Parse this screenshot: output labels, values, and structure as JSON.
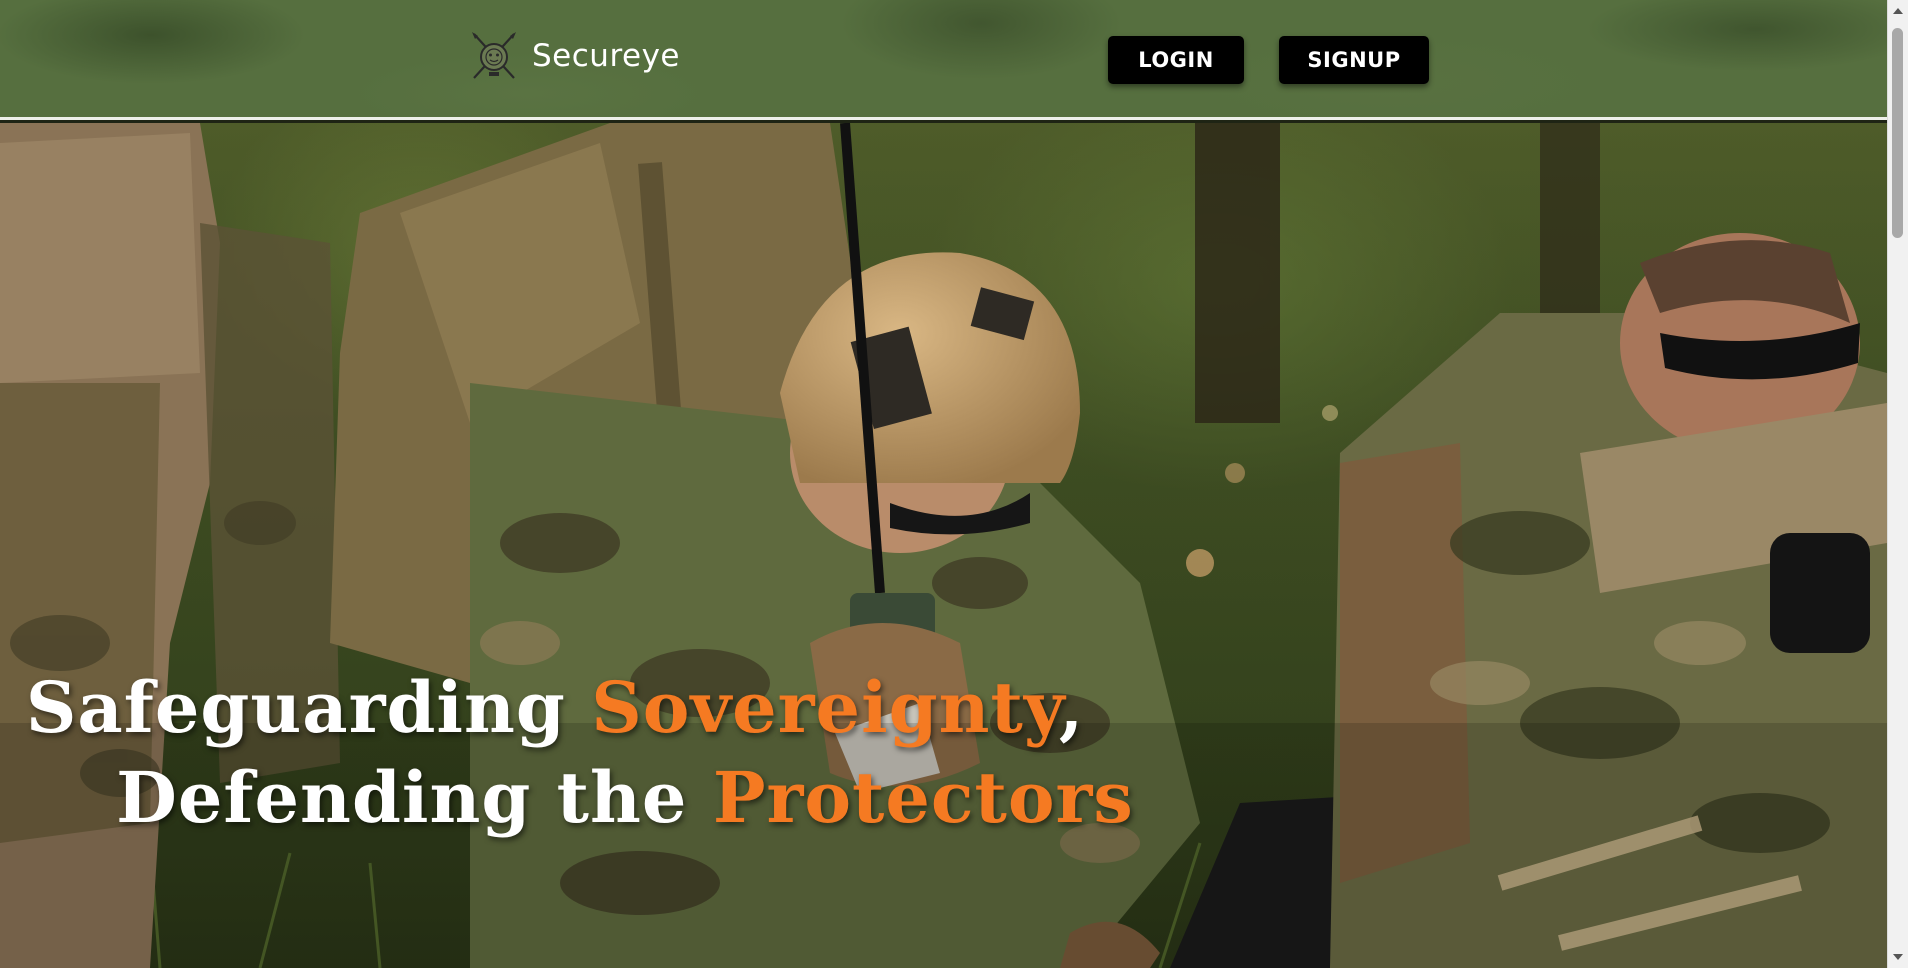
{
  "header": {
    "brand_name": "Secureye",
    "logo_icon": "crossed-swords-shield-icon",
    "login_label": "LOGIN",
    "signup_label": "SIGNUP"
  },
  "hero": {
    "line1_white": "Safeguarding ",
    "line1_accent": "Sovereignty",
    "line1_tail": ",",
    "line2_white": "Defending the ",
    "line2_accent": "Protectors",
    "image_subject": "soldiers in camouflage kneeling in a forest, one using a radio over a laptop"
  },
  "colors": {
    "header_green": "#566f3f",
    "button_black": "#000000",
    "accent_orange": "#f57a22",
    "text_white": "#ffffff"
  }
}
